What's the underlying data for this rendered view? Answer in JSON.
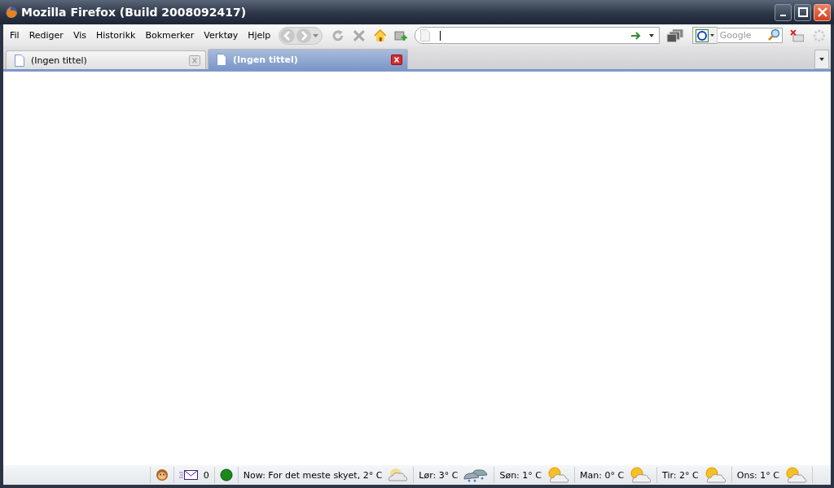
{
  "window": {
    "title": "Mozilla Firefox (Build 2008092417)"
  },
  "menu": [
    "Fil",
    "Rediger",
    "Vis",
    "Historikk",
    "Bokmerker",
    "Verktøy",
    "Hjelp"
  ],
  "search": {
    "placeholder": "Google"
  },
  "tabs": [
    {
      "label": "(Ingen tittel)",
      "selected": false
    },
    {
      "label": "(Ingen tittel)",
      "selected": true
    }
  ],
  "status_bar": {
    "mail_count": "0",
    "weather": [
      {
        "label": "Now: For det meste skyet, 2° C",
        "kind": "cloudy"
      },
      {
        "label": "Lør: 3° C",
        "kind": "snow"
      },
      {
        "label": "Søn: 1° C",
        "kind": "partly_sunny"
      },
      {
        "label": "Man: 0° C",
        "kind": "partly_sunny"
      },
      {
        "label": "Tir: 2° C",
        "kind": "partly_sunny"
      },
      {
        "label": "Ons: 1° C",
        "kind": "partly_sunny"
      }
    ]
  }
}
